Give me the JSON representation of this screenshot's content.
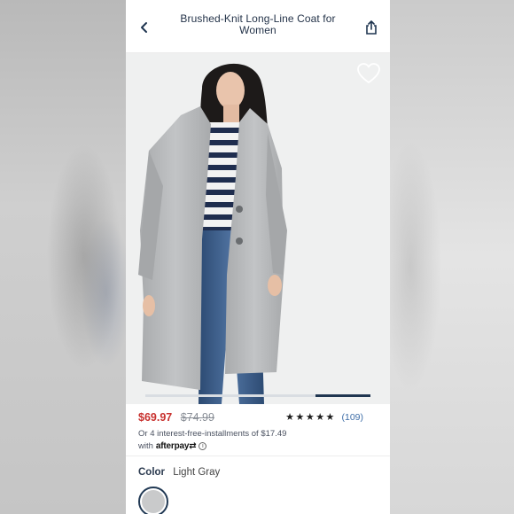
{
  "nav": {
    "title": "Brushed-Knit Long-Line Coat for Women"
  },
  "product": {
    "price": "$69.97",
    "original_price": "$74.99",
    "rating_stars": "★★★★★",
    "review_count": "(109)",
    "installments_text": "Or 4 interest-free-installments of $17.49",
    "with_text": "with",
    "afterpay_brand": "afterpay",
    "afterpay_symbol": "⇄",
    "info_symbol": "i"
  },
  "color": {
    "label": "Color",
    "value": "Light Gray",
    "swatch_hex": "#c9cacb"
  },
  "carousel": {
    "position_fraction": 0.75
  },
  "icons": {
    "back": "chevron-left-icon",
    "share": "share-icon",
    "favorite": "heart-outline-icon"
  },
  "colors": {
    "price": "#c8312e",
    "accent_navy": "#1f3550",
    "review_link": "#3f6ea8"
  }
}
